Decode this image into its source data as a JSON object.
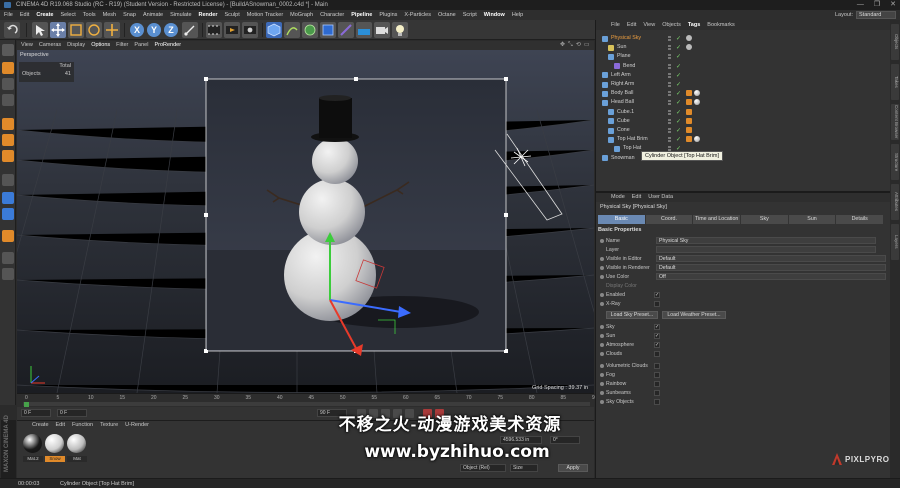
{
  "window": {
    "title": "CINEMA 4D R19.068 Studio (RC - R19) (Student Version - Restricted License) - [BuildASnowman_0002.c4d *] - Main",
    "controls": [
      "—",
      "❐",
      "✕"
    ]
  },
  "menubar": {
    "items": [
      "File",
      "Edit",
      "Create",
      "Select",
      "Tools",
      "Mesh",
      "Snap",
      "Animate",
      "Simulate",
      "Render",
      "Sculpt",
      "Motion Tracker",
      "MoGraph",
      "Character",
      "Pipeline",
      "Plugins",
      "X-Particles",
      "Octane",
      "Script",
      "Window",
      "Help"
    ],
    "layout_label": "Layout:",
    "layout_value": "Standard"
  },
  "toolbar": {
    "axis_x": "X",
    "axis_y": "Y",
    "axis_z": "Z"
  },
  "viewport": {
    "menu": [
      "View",
      "Cameras",
      "Display",
      "Options",
      "Filter",
      "Panel",
      "ProRender"
    ],
    "camera_label": "Perspective",
    "hud_header": "Total",
    "hud_objects_label": "Objects",
    "hud_objects_value": "41",
    "grid_spacing": "Grid Spacing : 39.37 in"
  },
  "timeline": {
    "ticks": [
      "0",
      "5",
      "10",
      "15",
      "20",
      "25",
      "30",
      "35",
      "40",
      "45",
      "50",
      "55",
      "60",
      "65",
      "70",
      "75",
      "80",
      "85",
      "90"
    ],
    "current_frame": "0 F",
    "start_frame": "0 F",
    "end_frame": "90 F"
  },
  "materials": {
    "menu": [
      "Create",
      "Edit",
      "Function",
      "Texture",
      "U-Render"
    ],
    "items": [
      {
        "name": "Mat.2",
        "color": "#1a1a1a"
      },
      {
        "name": "Snow",
        "color": "#cfcfcf"
      },
      {
        "name": "Mat",
        "color": "#bdbdbd"
      }
    ]
  },
  "coordinates": {
    "size_label": "4596.533 in",
    "zero_label": "0°",
    "mode_value": "Object (Rel)",
    "size_mode": "Size",
    "apply_label": "Apply"
  },
  "object_manager": {
    "menu": [
      "File",
      "Edit",
      "View",
      "Objects",
      "Tags",
      "Bookmarks"
    ],
    "rows": [
      {
        "name": "Physical Sky",
        "indent": 0,
        "selected": true,
        "color": "#6aa0d8"
      },
      {
        "name": "Sun",
        "indent": 1,
        "selected": false,
        "color": "#d8c25a"
      },
      {
        "name": "Plane",
        "indent": 1,
        "selected": false,
        "color": "#6aa0d8"
      },
      {
        "name": "Bend",
        "indent": 2,
        "selected": false,
        "color": "#8a6ad8"
      },
      {
        "name": "Left Arm",
        "indent": 0,
        "selected": false,
        "color": "#6aa0d8"
      },
      {
        "name": "Right Arm",
        "indent": 0,
        "selected": false,
        "color": "#6aa0d8"
      },
      {
        "name": "Body Ball",
        "indent": 0,
        "selected": false,
        "color": "#6aa0d8"
      },
      {
        "name": "Head Ball",
        "indent": 0,
        "selected": false,
        "color": "#6aa0d8"
      },
      {
        "name": "Cube.1",
        "indent": 1,
        "selected": false,
        "color": "#6aa0d8"
      },
      {
        "name": "Cube",
        "indent": 1,
        "selected": false,
        "color": "#6aa0d8"
      },
      {
        "name": "Cone",
        "indent": 1,
        "selected": false,
        "color": "#6aa0d8"
      },
      {
        "name": "Top Hat Brim",
        "indent": 1,
        "selected": false,
        "color": "#6aa0d8"
      },
      {
        "name": "Top Hat",
        "indent": 2,
        "selected": false,
        "color": "#6aa0d8"
      },
      {
        "name": "Snowman",
        "indent": 0,
        "selected": false,
        "color": "#6aa0d8"
      }
    ],
    "tooltip": "Cylinder Object [Top Hat Brim]"
  },
  "attribute_manager": {
    "menu": [
      "Mode",
      "Edit",
      "User Data"
    ],
    "title": "Physical Sky [Physical Sky]",
    "tabs": [
      "Basic",
      "Coord.",
      "Time and Location",
      "Sky",
      "Sun",
      "Details"
    ],
    "section": "Basic Properties",
    "name_label": "Name",
    "name_value": "Physical Sky",
    "layer_label": "Layer",
    "editor_label": "Visible in Editor",
    "editor_value": "Default",
    "renderer_label": "Visible in Renderer",
    "renderer_value": "Default",
    "usecolor_label": "Use Color",
    "usecolor_value": "Off",
    "dispcolor_label": "Display Color",
    "enabled_label": "Enabled",
    "xray_label": "X-Ray",
    "load_sky": "Load Sky Preset...",
    "load_weather": "Load Weather Preset...",
    "toggles": [
      {
        "label": "Sky",
        "checked": true
      },
      {
        "label": "Sun",
        "checked": true
      },
      {
        "label": "Atmosphere",
        "checked": true
      },
      {
        "label": "Clouds",
        "checked": false
      },
      {
        "label": "Volumetric Clouds",
        "checked": false
      },
      {
        "label": "Fog",
        "checked": false
      },
      {
        "label": "Rainbow",
        "checked": false
      },
      {
        "label": "Sunbeams",
        "checked": false
      },
      {
        "label": "Sky Objects",
        "checked": false
      }
    ]
  },
  "side_tabs": [
    "Objects",
    "Takes",
    "Content Browser",
    "Structure",
    "Attributes",
    "Layers"
  ],
  "status": {
    "time": "00:00:03",
    "text": "Cylinder Object [Top Hat Brim]"
  },
  "brand": {
    "maxon": "MAXON CINEMA 4D",
    "pixlpyro": "PIXLPYRO"
  },
  "watermark": {
    "line1": "不移之火-动漫游戏美术资源",
    "line2": "www.byzhihuo.com"
  }
}
